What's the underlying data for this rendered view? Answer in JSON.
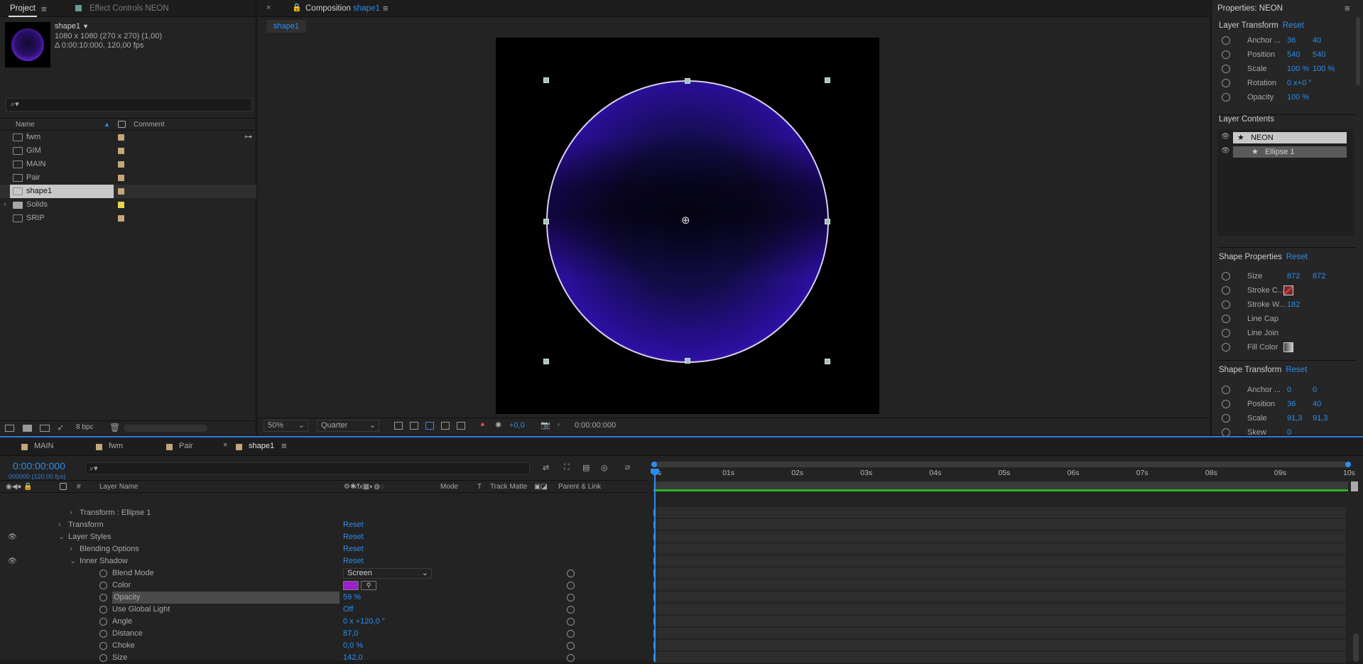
{
  "project": {
    "tabs": [
      "Project",
      "Effect Controls NEON"
    ],
    "thumb": {
      "name": "shape1",
      "size": "1080 x 1080  (270 x 270) (1,00)",
      "duration": "Δ 0:00:10:000, 120,00 fps"
    },
    "columns": {
      "name": "Name",
      "comment": "Comment"
    },
    "items": [
      {
        "name": "fwm",
        "label_color": "#c4a67a"
      },
      {
        "name": "GIM",
        "label_color": "#c4a67a"
      },
      {
        "name": "MAIN",
        "label_color": "#c4a67a"
      },
      {
        "name": "Pair",
        "label_color": "#c4a67a"
      },
      {
        "name": "shape1",
        "label_color": "#c4a67a"
      },
      {
        "name": "Solids",
        "label_color": "#e8d44d"
      },
      {
        "name": "SRIP",
        "label_color": "#c4a67a"
      }
    ],
    "bpc": "8 bpc"
  },
  "comp": {
    "title": "Composition",
    "title_name": "shape1",
    "breadcrumb": "shape1",
    "zoom": "50%",
    "resolution": "Quarter",
    "exposure": "+0,0",
    "timecode": "0:00:00:000"
  },
  "props": {
    "title": "Properties: NEON",
    "layer_transform": {
      "heading": "Layer Transform",
      "reset": "Reset"
    },
    "lt_rows": [
      {
        "label": "Anchor ...",
        "v1": "36",
        "v2": "40"
      },
      {
        "label": "Position",
        "v1": "540",
        "v2": "540"
      },
      {
        "label": "Scale",
        "v1": "100 %",
        "v2": "100 %"
      },
      {
        "label": "Rotation",
        "v1": "0 x+0 °",
        "v2": ""
      },
      {
        "label": "Opacity",
        "v1": "100 %",
        "v2": ""
      }
    ],
    "layer_contents": {
      "heading": "Layer Contents",
      "items": [
        "NEON",
        "Ellipse 1"
      ]
    },
    "shape_properties": {
      "heading": "Shape Properties",
      "reset": "Reset"
    },
    "sp_rows": [
      {
        "label": "Size",
        "v1": "872",
        "v2": "872"
      },
      {
        "label": "Stroke C...",
        "v1": "",
        "v2": ""
      },
      {
        "label": "Stroke W...",
        "v1": "182",
        "v2": ""
      },
      {
        "label": "Line Cap",
        "v1": "",
        "v2": ""
      },
      {
        "label": "Line Join",
        "v1": "",
        "v2": ""
      },
      {
        "label": "Fill Color",
        "v1": "",
        "v2": ""
      }
    ],
    "shape_transform": {
      "heading": "Shape Transform",
      "reset": "Reset"
    },
    "st_rows": [
      {
        "label": "Anchor ...",
        "v1": "0",
        "v2": "0"
      },
      {
        "label": "Position",
        "v1": "36",
        "v2": "40"
      },
      {
        "label": "Scale",
        "v1": "91,3",
        "v2": "91,3"
      },
      {
        "label": "Skew",
        "v1": "0",
        "v2": ""
      }
    ]
  },
  "timeline": {
    "tabs": [
      "MAIN",
      "fwm",
      "Pair",
      "shape1"
    ],
    "timecode": "0:00:00:000",
    "timecode_sub": "000000 (120.00 fps)",
    "columns": {
      "hash": "#",
      "layer_name": "Layer Name",
      "mode": "Mode",
      "t": "T",
      "track_matte": "Track Matte",
      "parent": "Parent & Link"
    },
    "rows": [
      {
        "label": "Transform : Ellipse 1",
        "indent": 2,
        "value": ""
      },
      {
        "label": "Transform",
        "indent": 1,
        "value": "Reset"
      },
      {
        "label": "Layer Styles",
        "indent": 1,
        "value": "Reset"
      },
      {
        "label": "Blending Options",
        "indent": 2,
        "value": "Reset"
      },
      {
        "label": "Inner Shadow",
        "indent": 2,
        "value": "Reset"
      },
      {
        "label": "Blend Mode",
        "indent": 3,
        "value": "Screen"
      },
      {
        "label": "Color",
        "indent": 3,
        "value": ""
      },
      {
        "label": "Opacity",
        "indent": 3,
        "value": "59 %"
      },
      {
        "label": "Use Global Light",
        "indent": 3,
        "value": "Off"
      },
      {
        "label": "Angle",
        "indent": 3,
        "value": "0 x +120,0 °"
      },
      {
        "label": "Distance",
        "indent": 3,
        "value": "87,0"
      },
      {
        "label": "Choke",
        "indent": 3,
        "value": "0,0 %"
      },
      {
        "label": "Size",
        "indent": 3,
        "value": "142,0"
      }
    ],
    "ruler": [
      "0s",
      "01s",
      "02s",
      "03s",
      "04s",
      "05s",
      "06s",
      "07s",
      "08s",
      "09s",
      "10s"
    ]
  },
  "colors": {
    "accent": "#2d8ceb",
    "inner_shadow": "#9b1fcf",
    "workarea": "#28b528"
  }
}
